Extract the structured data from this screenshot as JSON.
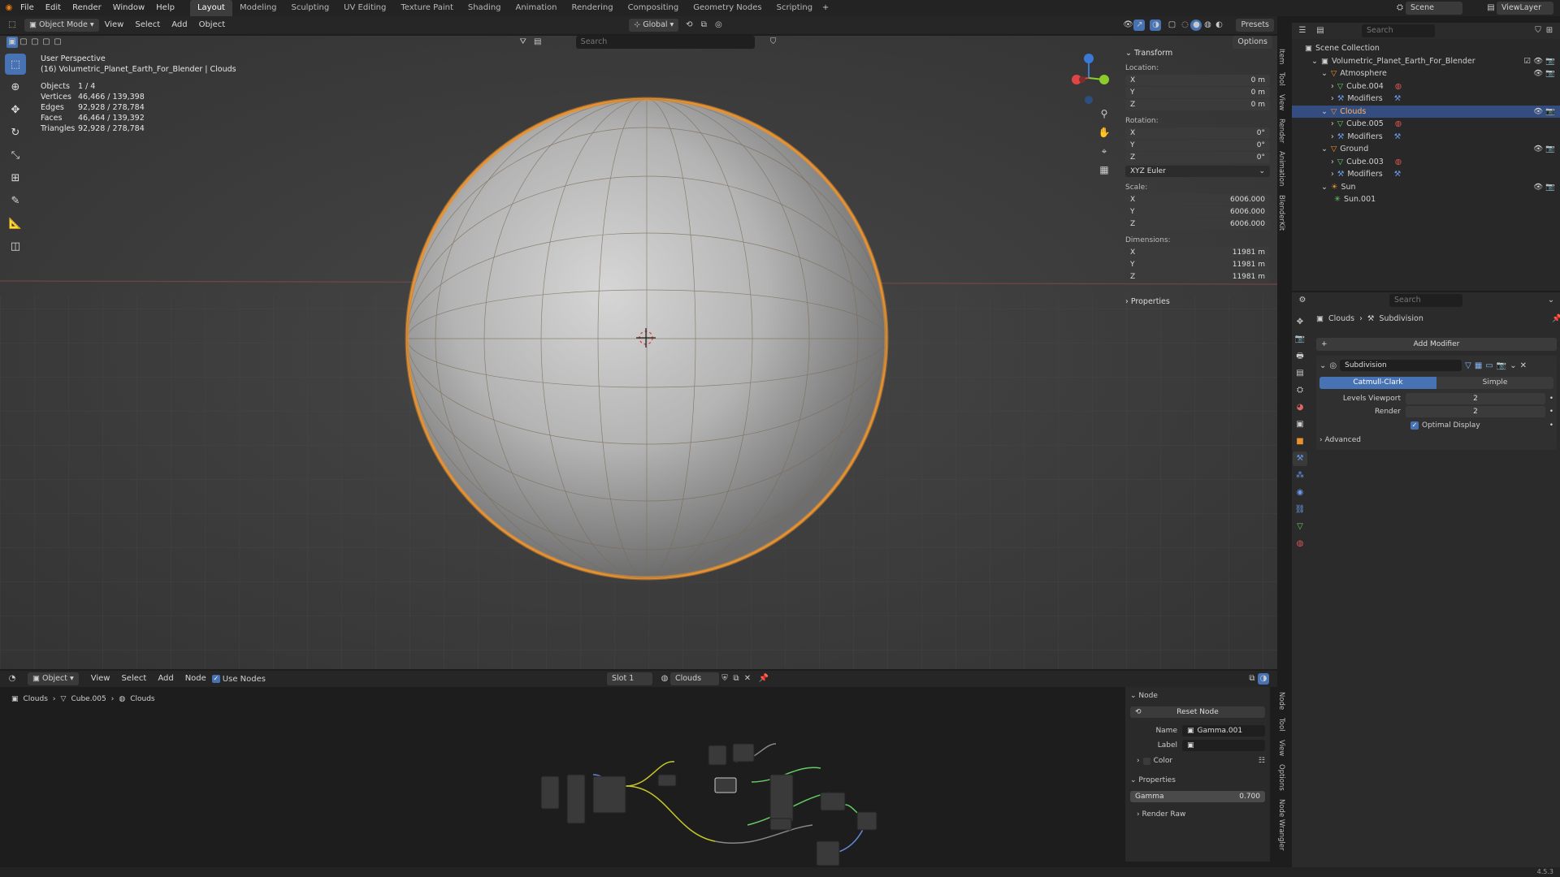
{
  "menu": [
    "File",
    "Edit",
    "Render",
    "Window",
    "Help"
  ],
  "workspaces": [
    "Layout",
    "Modeling",
    "Sculpting",
    "UV Editing",
    "Texture Paint",
    "Shading",
    "Animation",
    "Rendering",
    "Compositing",
    "Geometry Nodes",
    "Scripting"
  ],
  "active_workspace": "Layout",
  "scene_label": "Scene",
  "viewlayer_label": "ViewLayer",
  "header": {
    "mode": "Object Mode",
    "menus": [
      "View",
      "Select",
      "Add",
      "Object"
    ],
    "orientation": "Global",
    "presets": "Presets",
    "options": "Options",
    "search_placeholder": "Search"
  },
  "viewport": {
    "title": "User Perspective",
    "subtitle": "(16) Volumetric_Planet_Earth_For_Blender | Clouds",
    "stats": [
      [
        "Objects",
        "1 / 4"
      ],
      [
        "Vertices",
        "46,466 / 139,398"
      ],
      [
        "Edges",
        "92,928 / 278,784"
      ],
      [
        "Faces",
        "46,464 / 139,392"
      ],
      [
        "Triangles",
        "92,928 / 278,784"
      ]
    ]
  },
  "transform": {
    "title": "Transform",
    "location_label": "Location:",
    "location": [
      [
        "X",
        "0 m"
      ],
      [
        "Y",
        "0 m"
      ],
      [
        "Z",
        "0 m"
      ]
    ],
    "rotation_label": "Rotation:",
    "rotation": [
      [
        "X",
        "0°"
      ],
      [
        "Y",
        "0°"
      ],
      [
        "Z",
        "0°"
      ]
    ],
    "euler": "XYZ Euler",
    "scale_label": "Scale:",
    "scale": [
      [
        "X",
        "6006.000"
      ],
      [
        "Y",
        "6006.000"
      ],
      [
        "Z",
        "6006.000"
      ]
    ],
    "dimensions_label": "Dimensions:",
    "dimensions": [
      [
        "X",
        "11981 m"
      ],
      [
        "Y",
        "11981 m"
      ],
      [
        "Z",
        "11981 m"
      ]
    ],
    "properties": "Properties"
  },
  "side_tabs": [
    "Item",
    "Tool",
    "View",
    "Render",
    "Animation",
    "BlenderKit"
  ],
  "outliner": {
    "search_placeholder": "Search",
    "scene_collection": "Scene Collection",
    "file": "Volumetric_Planet_Earth_For_Blender",
    "rows": [
      [
        "Atmosphere",
        1,
        "obj"
      ],
      [
        "Cube.004",
        2,
        "mesh"
      ],
      [
        "Modifiers",
        2,
        "mod"
      ],
      [
        "Clouds",
        1,
        "obj"
      ],
      [
        "Cube.005",
        2,
        "mesh"
      ],
      [
        "Modifiers",
        2,
        "mod"
      ],
      [
        "Ground",
        1,
        "obj"
      ],
      [
        "Cube.003",
        2,
        "mesh"
      ],
      [
        "Modifiers",
        2,
        "mod"
      ],
      [
        "Sun",
        1,
        "light"
      ],
      [
        "Sun.001",
        2,
        "lightdata"
      ]
    ]
  },
  "properties": {
    "search_placeholder": "Search",
    "breadcrumb_obj": "Clouds",
    "breadcrumb_mod": "Subdivision",
    "add_modifier": "Add Modifier",
    "modifier_name": "Subdivision",
    "catmull": "Catmull-Clark",
    "simple": "Simple",
    "levels_viewport_label": "Levels Viewport",
    "levels_viewport": "2",
    "render_label": "Render",
    "render": "2",
    "optimal": "Optimal Display",
    "advanced": "Advanced"
  },
  "node_header": {
    "object": "Object",
    "menus": [
      "View",
      "Select",
      "Add",
      "Node"
    ],
    "use_nodes": "Use Nodes",
    "slot": "Slot 1",
    "material": "Clouds"
  },
  "node_breadcrumb": [
    "Clouds",
    "Cube.005",
    "Clouds"
  ],
  "node_panel": {
    "node_title": "Node",
    "reset": "Reset Node",
    "name_label": "Name",
    "name": "Gamma.001",
    "label_label": "Label",
    "color": "Color",
    "properties": "Properties",
    "gamma_label": "Gamma",
    "gamma": "0.700",
    "render_raw": "Render Raw"
  },
  "node_side_tabs": [
    "Node",
    "Tool",
    "View",
    "Options",
    "Node Wrangler"
  ],
  "version": "4.5.3"
}
